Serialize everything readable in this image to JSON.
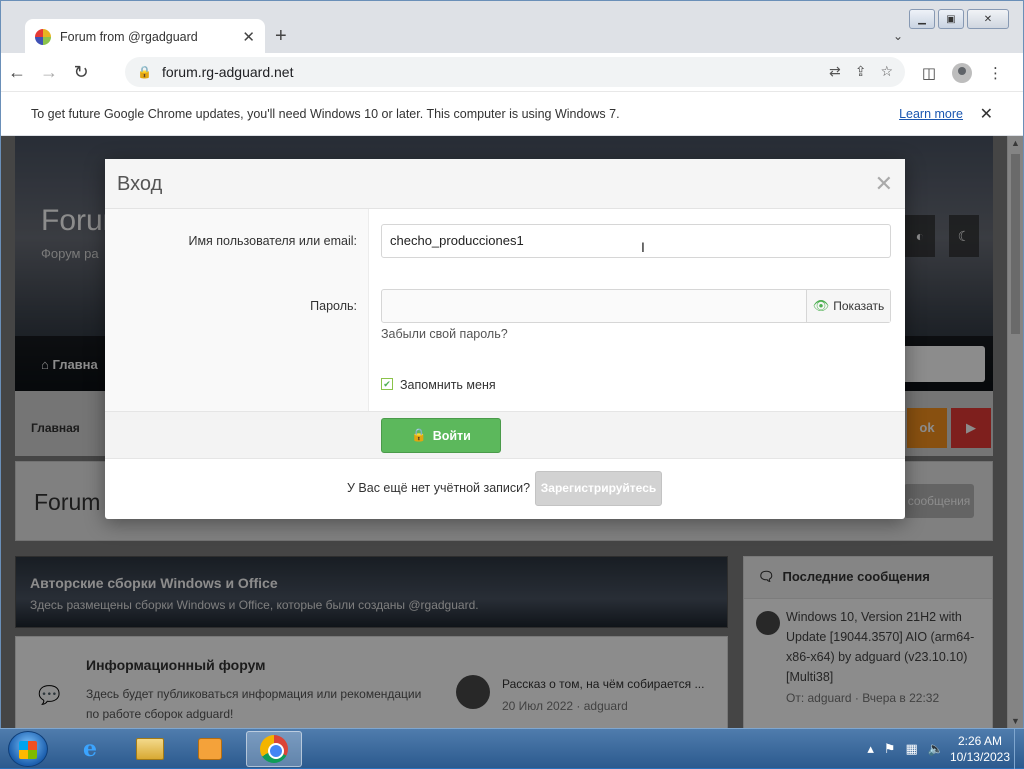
{
  "browser": {
    "tab_title": "Forum from @rgadguard",
    "url": "forum.rg-adguard.net",
    "infobar_text": "To get future Google Chrome updates, you'll need Windows 10 or later. This computer is using Windows 7.",
    "infobar_link": "Learn more"
  },
  "site": {
    "hero_title": "Forum",
    "hero_subtitle": "Форум ра",
    "nav_home": "Главна",
    "breadcrumb_home": "Главная",
    "page_title": "Forum f",
    "new_messages_btn": "сообщения",
    "category": {
      "title": "Авторские сборки Windows и Office",
      "description": "Здесь размещены сборки Windows и Office, которые были созданы @rgadguard."
    },
    "node": {
      "title": "Информационный форум",
      "description": "Здесь будет публиковаться информация или рекомендации по работе сборок adguard!",
      "latest_title": "Рассказ о том, на чём собирается ...",
      "latest_meta": "20 Июл 2022 · adguard"
    },
    "sidebar": {
      "heading": "Последние сообщения",
      "post_title": "Windows 10, Version 21H2 with Update [19044.3570] AIO (arm64-x86-x64) by adguard (v23.10.10) [Multi38]",
      "post_meta": "От: adguard · Вчера в 22:32"
    }
  },
  "login_modal": {
    "title": "Вход",
    "username_label": "Имя пользователя или email:",
    "username_value": "checho_producciones1",
    "password_label": "Пароль:",
    "password_value": "",
    "show_password": "Показать",
    "forgot_password": "Забыли свой пароль?",
    "remember_me": "Запомнить меня",
    "remember_checked": true,
    "login_button": "Войти",
    "no_account_text": "У Вас ещё нет учётной записи?",
    "register_button": "Зарегистрируйтесь"
  },
  "taskbar": {
    "time": "2:26 AM",
    "date": "10/13/2023"
  },
  "colors": {
    "login_green": "#5cb85c",
    "link_blue": "#1a56b0",
    "ok_orange": "#f7931e",
    "youtube_red": "#e53935"
  }
}
